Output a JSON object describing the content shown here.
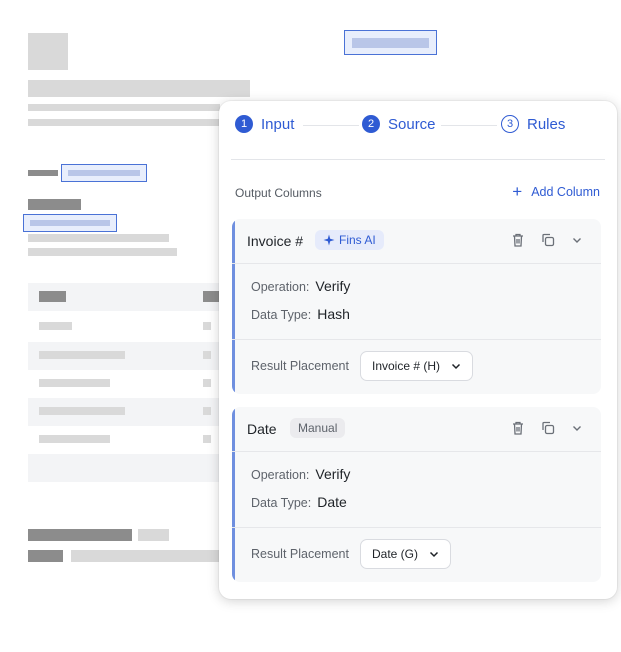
{
  "stepper": {
    "steps": [
      {
        "num": "1",
        "label": "Input",
        "state": "filled"
      },
      {
        "num": "2",
        "label": "Source",
        "state": "filled"
      },
      {
        "num": "3",
        "label": "Rules",
        "state": "outline"
      }
    ]
  },
  "output": {
    "header": "Output Columns",
    "add_label": "Add Column"
  },
  "cards": [
    {
      "title": "Invoice #",
      "badge": "Fins AI",
      "badge_icon": "sparkle-icon",
      "operation_label": "Operation:",
      "operation_value": "Verify",
      "datatype_label": "Data Type:",
      "datatype_value": "Hash",
      "placement_label": "Result Placement",
      "placement_value": "Invoice # (H)"
    },
    {
      "title": "Date",
      "badge": "Manual",
      "operation_label": "Operation:",
      "operation_value": "Verify",
      "datatype_label": "Data Type:",
      "datatype_value": "Date",
      "placement_label": "Result Placement",
      "placement_value": "Date (G)"
    }
  ],
  "colors": {
    "accent": "#2f5bd3",
    "card_bar": "#6f8fdf",
    "ai_badge_bg": "#e6ebfb",
    "manual_badge_bg": "#ebebee"
  }
}
